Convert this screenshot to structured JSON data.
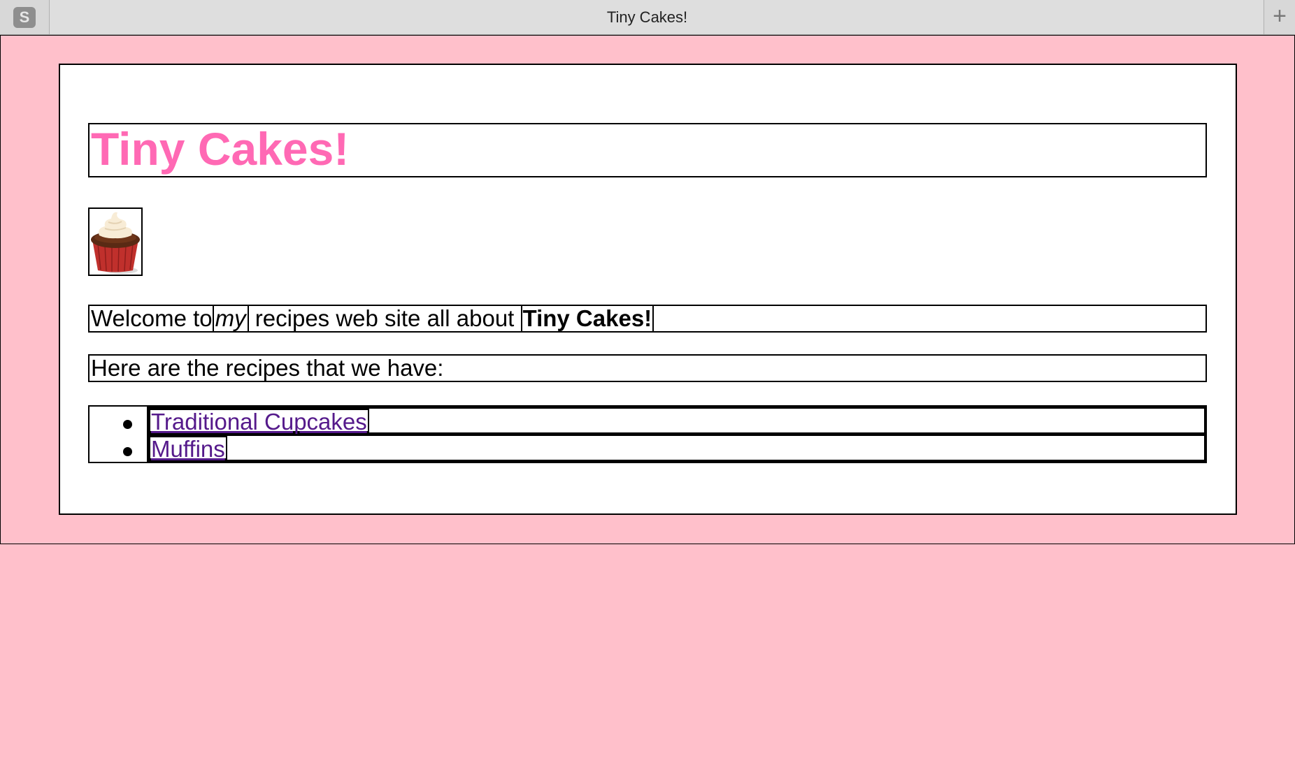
{
  "browser": {
    "sidebar_icon_letter": "S",
    "tab_title": "Tiny Cakes!",
    "new_tab_symbol": "+"
  },
  "page": {
    "heading": "Tiny Cakes!",
    "welcome": {
      "part1": "Welcome to ",
      "emphasis": "my",
      "part2": " recipes web site all about ",
      "strong": "Tiny Cakes!"
    },
    "intro": "Here are the recipes that we have:",
    "recipes": [
      {
        "label": "Traditional Cupcakes"
      },
      {
        "label": "Muffins"
      }
    ]
  },
  "colors": {
    "background": "#ffc0cb",
    "heading": "#ff69b4",
    "link_visited": "#551a8b"
  }
}
